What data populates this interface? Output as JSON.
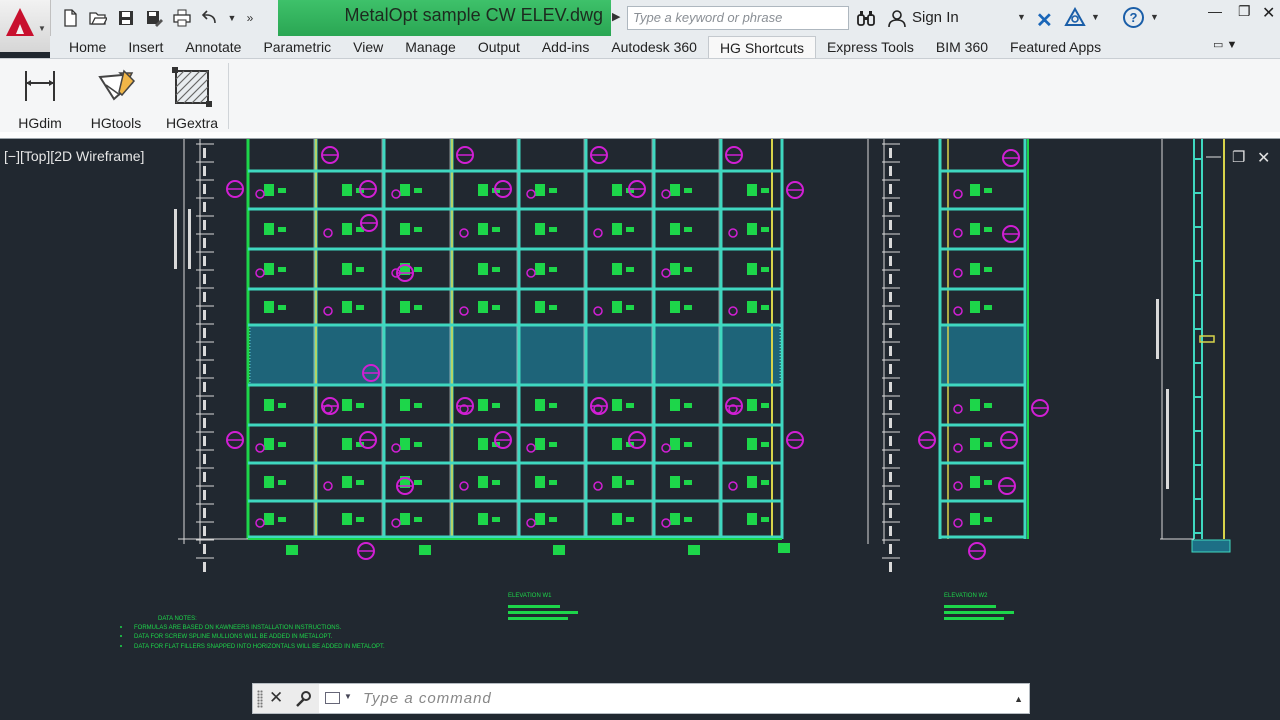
{
  "window": {
    "file_title": "MetalOpt sample CW ELEV.dwg",
    "search_placeholder": "Type a keyword or phrase",
    "signin": "Sign In"
  },
  "ribbon": {
    "tabs": [
      "Home",
      "Insert",
      "Annotate",
      "Parametric",
      "View",
      "Manage",
      "Output",
      "Add-ins",
      "Autodesk 360",
      "HG Shortcuts",
      "Express Tools",
      "BIM 360",
      "Featured Apps"
    ],
    "active_tab": "HG Shortcuts",
    "buttons": [
      {
        "label": "HGdim",
        "icon": "dimension-icon"
      },
      {
        "label": "HGtools",
        "icon": "tools-icon"
      },
      {
        "label": "HGextra",
        "icon": "hatch-icon"
      }
    ]
  },
  "viewport": {
    "label": "[−][Top][2D Wireframe]",
    "elevation_title_1": "ELEVATION W1",
    "elevation_title_2": "ELEVATION W2",
    "data_notes_title": "DATA NOTES:",
    "data_notes": [
      "FORMULAS ARE BASED ON KAWNEERS INSTALLATION INSTRUCTIONS.",
      "DATA FOR SCREW SPLINE MULLIONS WILL BE ADDED IN METALOPT.",
      "DATA FOR FLAT FILLERS SNAPPED INTO HORIZONTALS WILL BE ADDED IN METALOPT."
    ]
  },
  "command_line": {
    "placeholder": "Type  a  command"
  },
  "colors": {
    "background": "#212830",
    "accent_green": "#2aa653",
    "grid_cyan": "#3fd8c0",
    "tag_magenta": "#d11fd4"
  }
}
